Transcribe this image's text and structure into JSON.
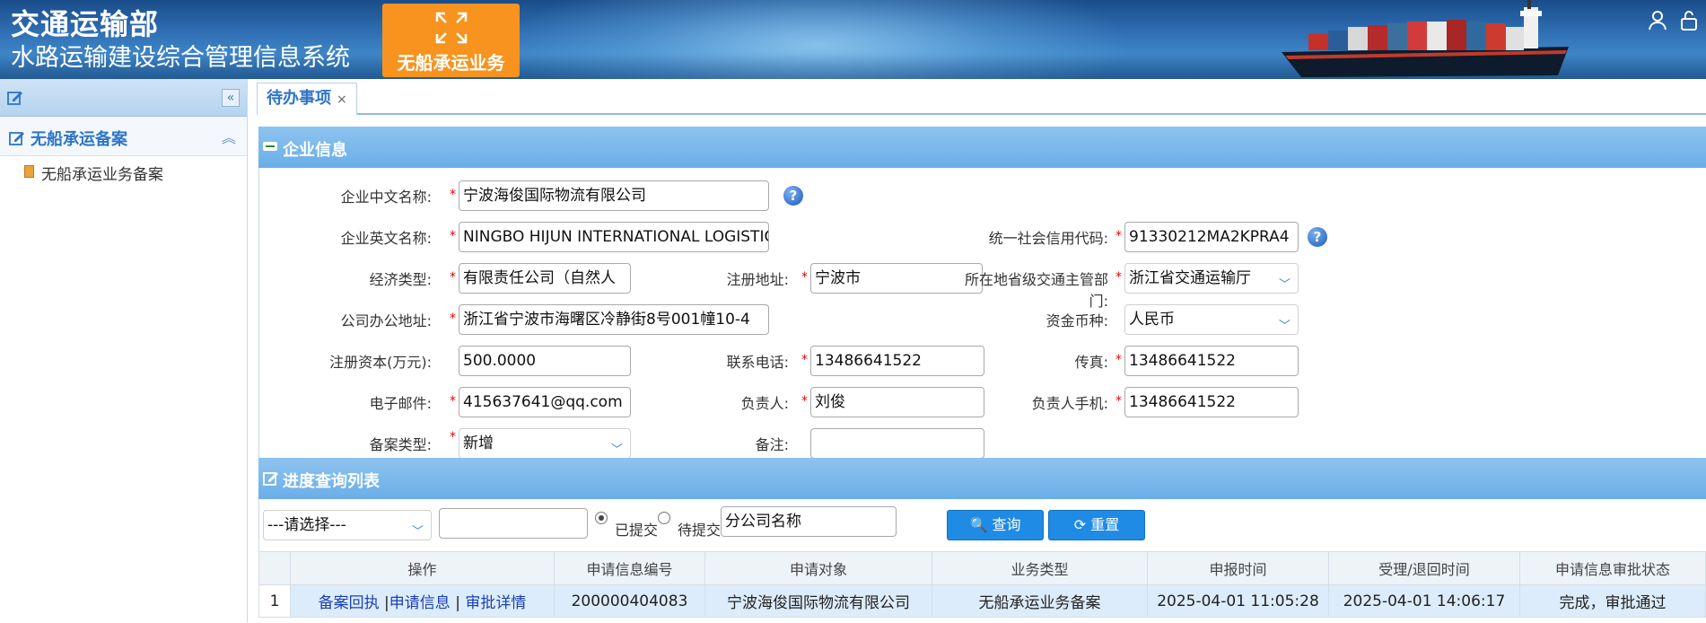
{
  "header": {
    "org": "交通运输部",
    "system": "水路运输建设综合管理信息系统",
    "module_button": "无船承运业务",
    "user_icon": "user-icon",
    "lock_icon": "lock-icon"
  },
  "sidebar": {
    "section_title": "无船承运备案",
    "items": [
      {
        "label": "无船承运业务备案"
      }
    ]
  },
  "tabs": [
    {
      "label": "待办事项",
      "close": "×"
    }
  ],
  "enterprise_panel": {
    "title": "企业信息",
    "fields": {
      "cn_name": {
        "label": "企业中文名称:",
        "value": "宁波海俊国际物流有限公司"
      },
      "en_name": {
        "label": "企业英文名称:",
        "value": "NINGBO HIJUN INTERNATIONAL LOGISTICS CO., LTD."
      },
      "credit_code": {
        "label": "统一社会信用代码:",
        "value": "91330212MA2KPRA4"
      },
      "econ_type": {
        "label": "经济类型:",
        "value": "有限责任公司（自然人"
      },
      "reg_addr": {
        "label": "注册地址:",
        "value": "宁波市"
      },
      "province_dept": {
        "label": "所在地省级交通主管部门:",
        "value": "浙江省交通运输厅"
      },
      "office_addr": {
        "label": "公司办公地址:",
        "value": "浙江省宁波市海曙区冷静街8号001幢10-4"
      },
      "currency": {
        "label": "资金币种:",
        "value": "人民币"
      },
      "capital": {
        "label": "注册资本(万元):",
        "value": "500.0000"
      },
      "phone": {
        "label": "联系电话:",
        "value": "13486641522"
      },
      "fax": {
        "label": "传真:",
        "value": "13486641522"
      },
      "email": {
        "label": "电子邮件:",
        "value": "415637641@qq.com"
      },
      "principal": {
        "label": "负责人:",
        "value": "刘俊"
      },
      "principal_mobile": {
        "label": "负责人手机:",
        "value": "13486641522"
      },
      "record_type": {
        "label": "备案类型:",
        "value": "新增"
      },
      "remark": {
        "label": "备注:",
        "value": ""
      }
    }
  },
  "progress_panel": {
    "title": "进度查询列表",
    "filter_select": "---请选择---",
    "filter_input": "",
    "radio_submitted": "已提交",
    "radio_pending": "待提交",
    "branch_name": "分公司名称",
    "query_button": "查询",
    "reset_button": "重置",
    "columns": [
      "",
      "操作",
      "申请信息编号",
      "申请对象",
      "业务类型",
      "申报时间",
      "受理/退回时间",
      "申请信息审批状态"
    ],
    "rows": [
      {
        "index": "1",
        "action_receipt": "备案回执",
        "action_info": "申请信息",
        "action_detail": "审批详情",
        "sep1": " |",
        "sep2": " | ",
        "app_no": "200000404083",
        "applicant": "宁波海俊国际物流有限公司",
        "biz_type": "无船承运业务备案",
        "submit_time": "2025-04-01 11:05:28",
        "accept_time": "2025-04-01 14:06:17",
        "status": "完成，审批通过"
      }
    ]
  }
}
